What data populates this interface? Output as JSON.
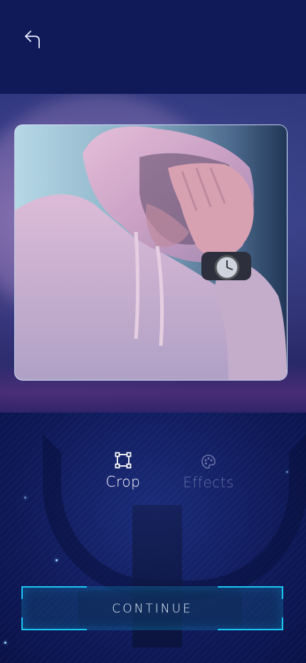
{
  "header": {
    "back_icon": "back-arrow-icon"
  },
  "photo": {
    "description_icon": "photo"
  },
  "tools": {
    "crop": {
      "label": "Crop",
      "icon": "crop-icon",
      "active": true
    },
    "effects": {
      "label": "Effects",
      "icon": "palette-icon",
      "active": false
    }
  },
  "footer": {
    "continue_label": "CONTINUE"
  },
  "colors": {
    "background": "#0b1452",
    "accent": "#19c7f5",
    "inactive_label": "#8f9ac8"
  }
}
